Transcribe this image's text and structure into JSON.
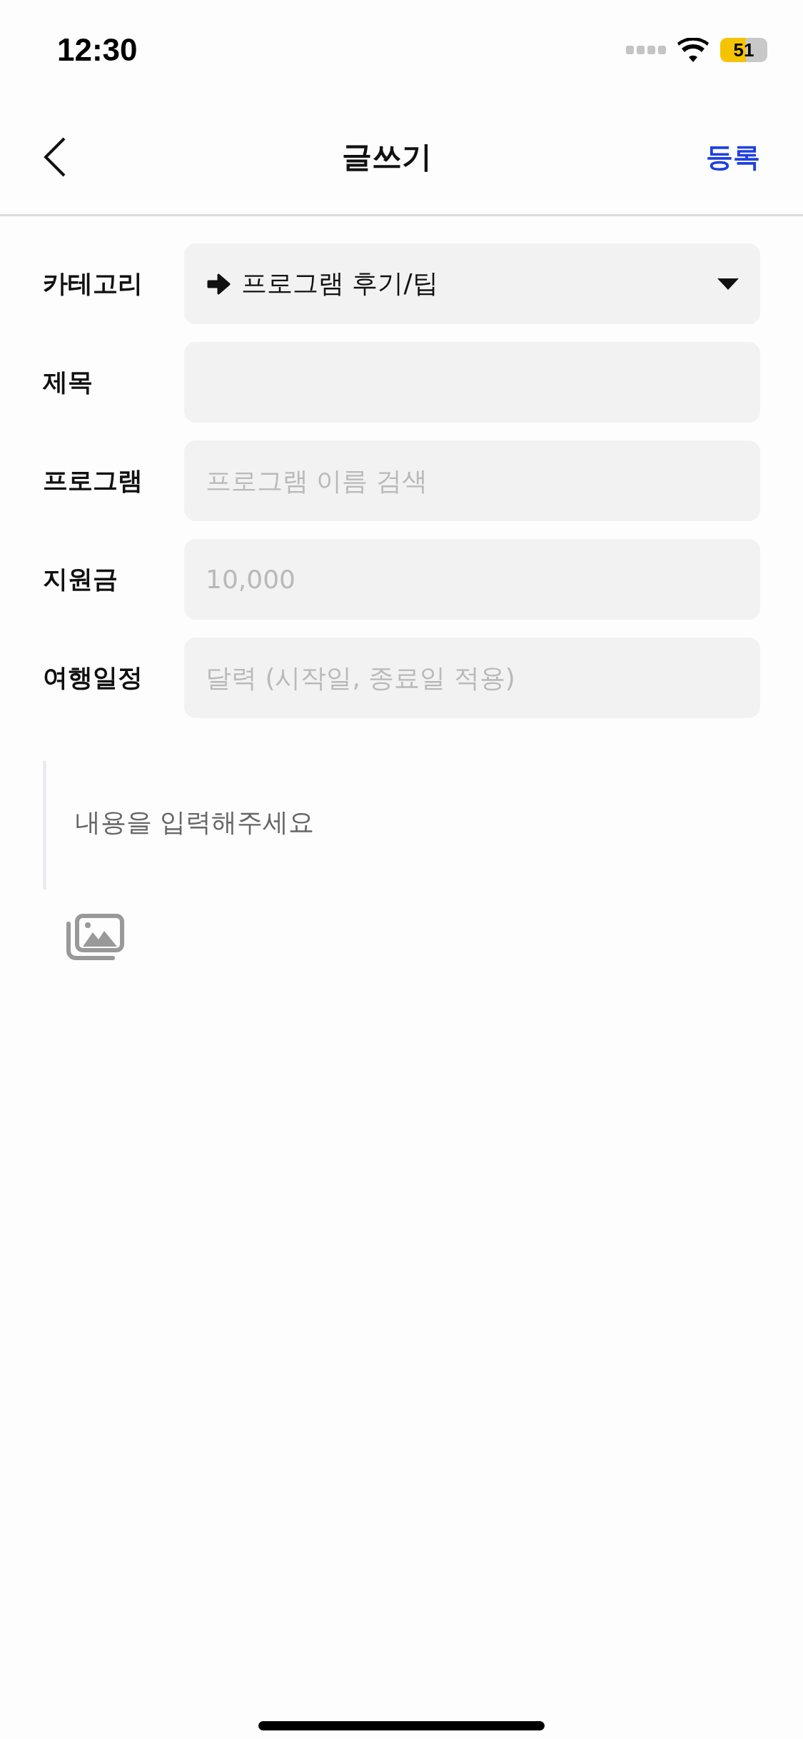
{
  "status_bar": {
    "time": "12:30",
    "battery": "51"
  },
  "nav": {
    "title": "글쓰기",
    "action": "등록"
  },
  "fields": [
    {
      "label": "카테고리",
      "kind": "select",
      "value": "프로그램 후기/팁"
    },
    {
      "label": "제목",
      "kind": "input"
    },
    {
      "label": "프로그램",
      "kind": "input",
      "placeholder": "프로그램 이름 검색"
    },
    {
      "label": "지원금",
      "kind": "input",
      "placeholder": "10,000"
    },
    {
      "label": "여행일정",
      "kind": "input",
      "placeholder": "달력 (시작일, 종료일 적용)"
    }
  ],
  "content": {
    "placeholder": "내용을 입력해주세요"
  }
}
